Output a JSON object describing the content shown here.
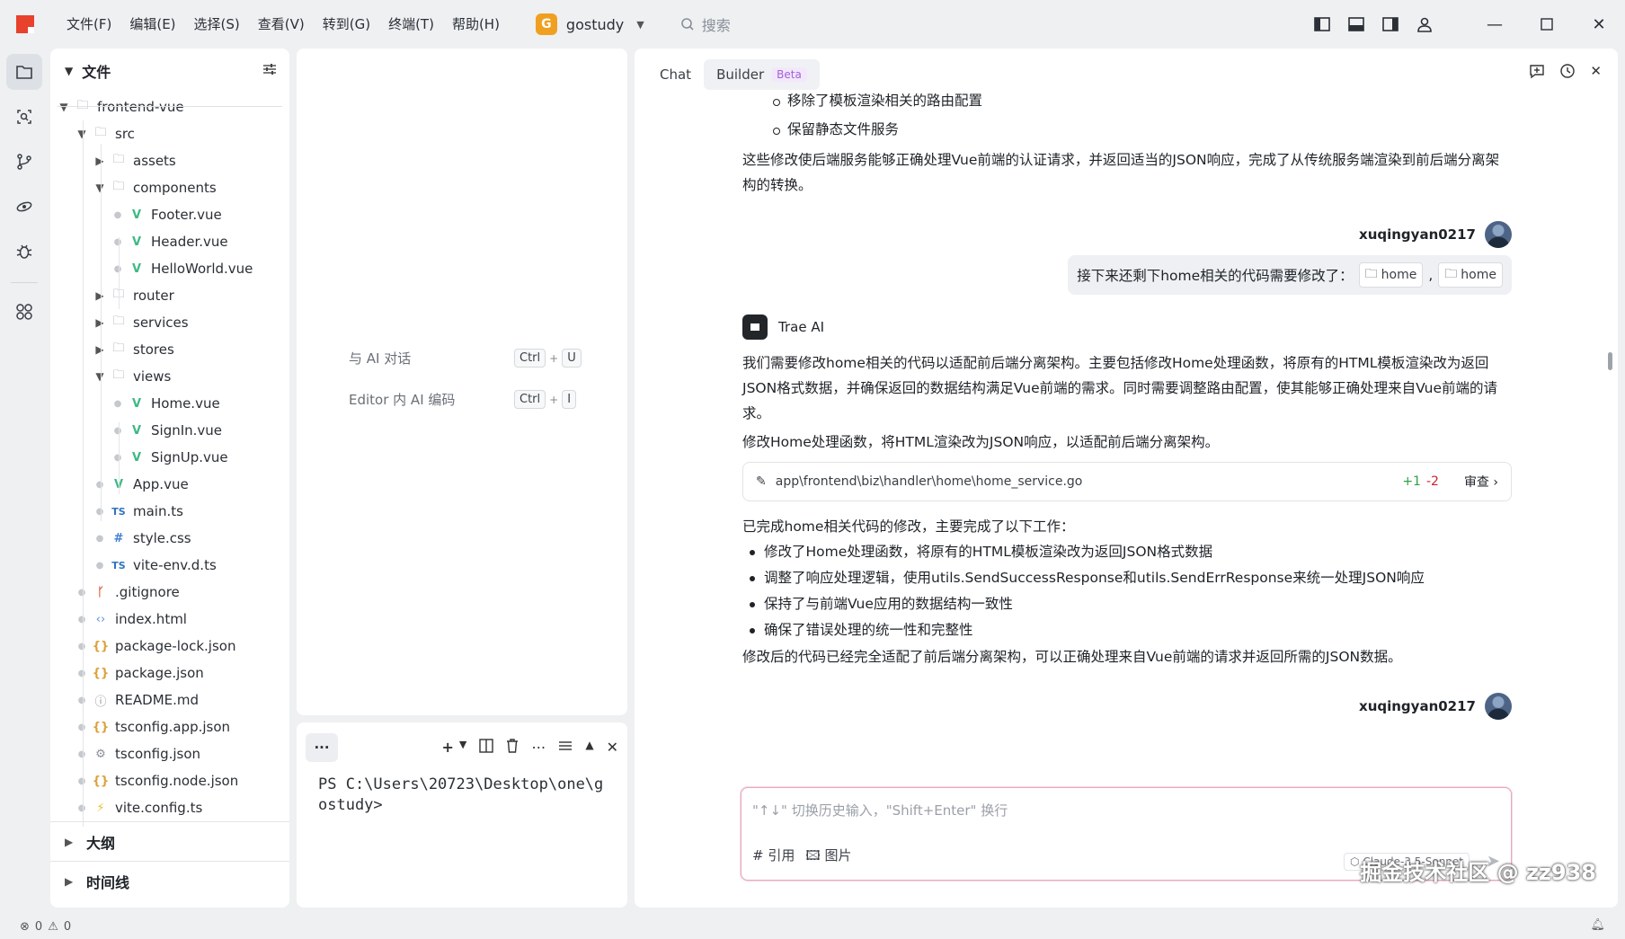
{
  "menus": [
    "文件(F)",
    "编辑(E)",
    "选择(S)",
    "查看(V)",
    "转到(G)",
    "终端(T)",
    "帮助(H)"
  ],
  "project": {
    "badge": "G",
    "name": "gostudy"
  },
  "search": {
    "placeholder": "搜索"
  },
  "explorer": {
    "title": "文件",
    "items": [
      {
        "label": "frontend-vue",
        "type": "folder",
        "expanded": true
      },
      {
        "label": "src",
        "type": "folder",
        "expanded": true
      },
      {
        "label": "assets",
        "type": "folder",
        "expanded": false
      },
      {
        "label": "components",
        "type": "folder",
        "expanded": true
      },
      {
        "label": "Footer.vue",
        "type": "vue"
      },
      {
        "label": "Header.vue",
        "type": "vue"
      },
      {
        "label": "HelloWorld.vue",
        "type": "vue"
      },
      {
        "label": "router",
        "type": "folder",
        "expanded": false
      },
      {
        "label": "services",
        "type": "folder",
        "expanded": false
      },
      {
        "label": "stores",
        "type": "folder",
        "expanded": false
      },
      {
        "label": "views",
        "type": "folder",
        "expanded": true
      },
      {
        "label": "Home.vue",
        "type": "vue"
      },
      {
        "label": "SignIn.vue",
        "type": "vue"
      },
      {
        "label": "SignUp.vue",
        "type": "vue"
      },
      {
        "label": "App.vue",
        "type": "vue"
      },
      {
        "label": "main.ts",
        "type": "ts"
      },
      {
        "label": "style.css",
        "type": "css"
      },
      {
        "label": "vite-env.d.ts",
        "type": "ts"
      },
      {
        "label": ".gitignore",
        "type": "git"
      },
      {
        "label": "index.html",
        "type": "html"
      },
      {
        "label": "package-lock.json",
        "type": "json"
      },
      {
        "label": "package.json",
        "type": "json"
      },
      {
        "label": "README.md",
        "type": "md"
      },
      {
        "label": "tsconfig.app.json",
        "type": "json"
      },
      {
        "label": "tsconfig.json",
        "type": "tsconfig"
      },
      {
        "label": "tsconfig.node.json",
        "type": "json"
      },
      {
        "label": "vite.config.ts",
        "type": "vite"
      }
    ],
    "sections": [
      "大纲",
      "时间线"
    ]
  },
  "ai_panel": {
    "shortcut1": {
      "label": "与 AI 对话",
      "key1": "Ctrl",
      "key2": "U"
    },
    "shortcut2": {
      "label": "Editor 内 AI 编码",
      "key1": "Ctrl",
      "key2": "I"
    },
    "plus": "+"
  },
  "terminal": {
    "more": "···",
    "text": "PS C:\\Users\\20723\\Desktop\\one\\gostudy>"
  },
  "chat": {
    "tab_chat": "Chat",
    "tab_builder": "Builder",
    "beta": "Beta",
    "sub_bullet1": "移除了模板渲染相关的路由配置",
    "sub_bullet2": "保留静态文件服务",
    "para1": "这些修改使后端服务能够正确处理Vue前端的认证请求，并返回适当的JSON响应，完成了从传统服务端渲染到前后端分离架构的转换。",
    "user_name": "xuqingyan0217",
    "user_msg": "接下来还剩下home相关的代码需要修改了：",
    "chip1": "home",
    "chip2": "home",
    "chip_sep": ",",
    "bot_name": "Trae AI",
    "para2": "我们需要修改home相关的代码以适配前后端分离架构。主要包括修改Home处理函数，将原有的HTML模板渲染改为返回JSON格式数据，并确保返回的数据结构满足Vue前端的需求。同时需要调整路由配置，使其能够正确处理来自Vue前端的请求。",
    "para3": "修改Home处理函数，将HTML渲染改为JSON响应，以适配前后端分离架构。",
    "file_path": "app\\frontend\\biz\\handler\\home\\home_service.go",
    "file_add": "+1",
    "file_del": "-2",
    "file_review": "审查",
    "para4": "已完成home相关代码的修改，主要完成了以下工作：",
    "bullets": [
      "修改了Home处理函数，将原有的HTML模板渲染改为返回JSON格式数据",
      "调整了响应处理逻辑，使用utils.SendSuccessResponse和utils.SendErrResponse来统一处理JSON响应",
      "保持了与前端Vue应用的数据结构一致性",
      "确保了错误处理的统一性和完整性"
    ],
    "para5": "修改后的代码已经完全适配了前后端分离架构，可以正确处理来自Vue前端的请求并返回所需的JSON数据。",
    "user_name2": "xuqingyan0217",
    "input_placeholder": "\"↑↓\" 切换历史输入，\"Shift+Enter\" 换行",
    "tool_quote": "# 引用",
    "tool_image": "图片",
    "model": "Claude-3.5-Sonnet",
    "watermark": "掘金技术社区 @ zz938"
  },
  "status": {
    "errors": "0",
    "warnings": "0"
  }
}
